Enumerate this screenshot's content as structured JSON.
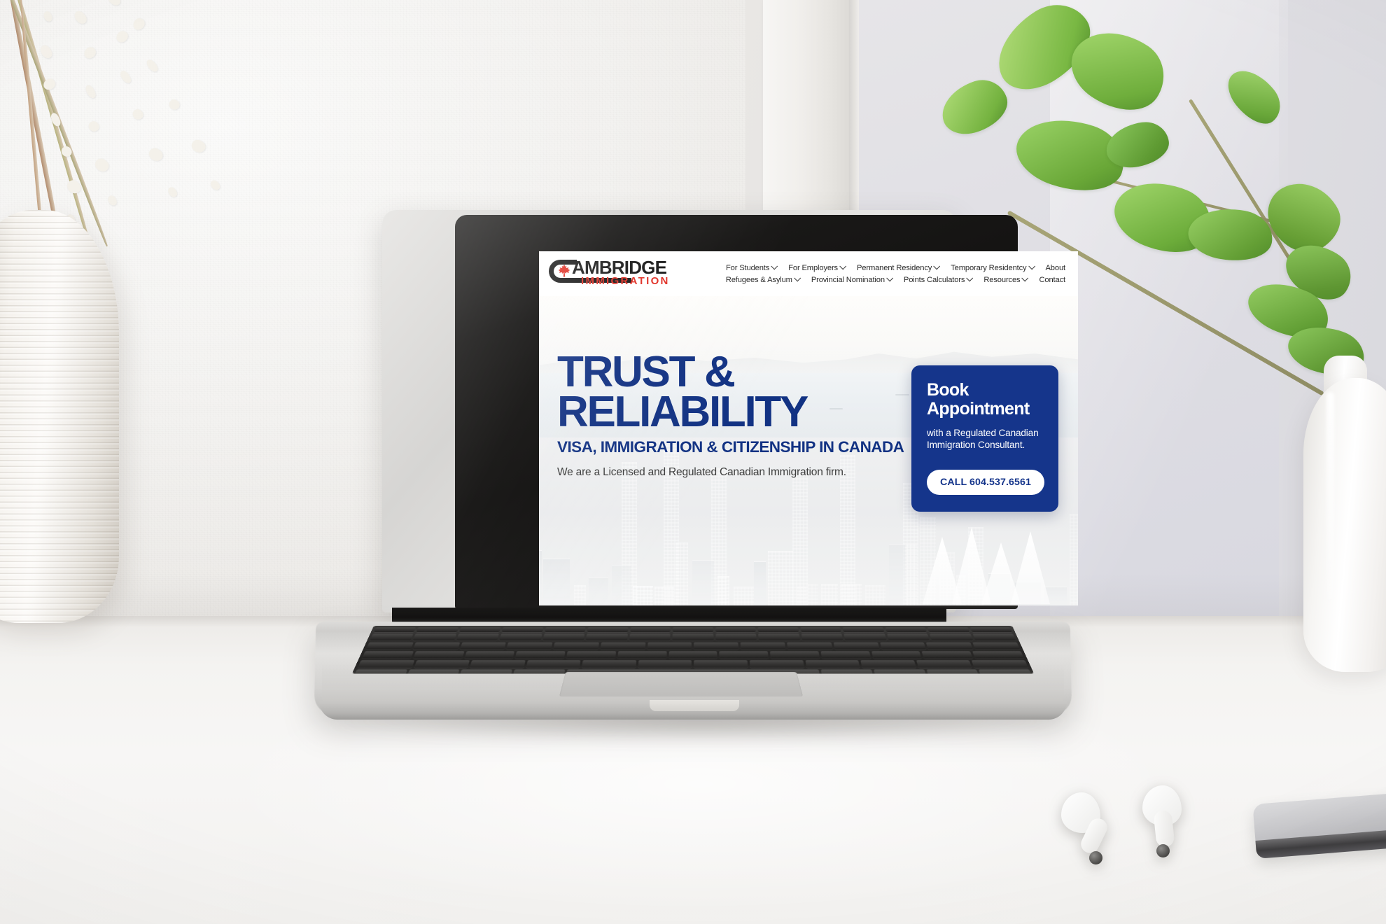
{
  "scene": {
    "description": "Laptop on a white desk showing the Cambridge Immigration website homepage",
    "objects": {
      "vase_left": "ribbed-white-vase-with-pussy-willow",
      "vase_right": "glossy-white-bottle-vase-with-ficus",
      "earbuds": "white-wireless-earbuds",
      "phone": "silver-smartphone"
    }
  },
  "site": {
    "logo": {
      "mark": "maple-leaf-in-c",
      "word": "AMBRIDGE",
      "subword": "IMMIGRATION",
      "word_color": "#111111",
      "subword_color": "#e02b20"
    },
    "nav": {
      "row1": [
        {
          "label": "For Students",
          "caret": true
        },
        {
          "label": "For Employers",
          "caret": true
        },
        {
          "label": "Permanent Residency",
          "caret": true
        },
        {
          "label": "Temporary Residentcy",
          "caret": true
        },
        {
          "label": "About",
          "caret": false
        }
      ],
      "row2": [
        {
          "label": "Refugees & Asylum",
          "caret": true
        },
        {
          "label": "Provincial Nomination",
          "caret": true
        },
        {
          "label": "Points Calculators",
          "caret": true
        },
        {
          "label": "Resources",
          "caret": true
        },
        {
          "label": "Contact",
          "caret": false
        }
      ]
    },
    "hero": {
      "headline": "TRUST &\nRELIABILITY",
      "subheadline": "VISA, IMMIGRATION & CITIZENSHIP IN CANADA",
      "paragraph": "We are a Licensed and Regulated Canadian Immigration firm.",
      "headline_color": "#123283",
      "background": "aerial-vancouver-skyline"
    },
    "cta": {
      "title": "Book\nAppointment",
      "subtitle": "with a Regulated Canadian Immigration Consultant.",
      "button_label": "CALL 604.537.6561",
      "card_color": "#15358b",
      "button_text_color": "#15358b"
    }
  }
}
